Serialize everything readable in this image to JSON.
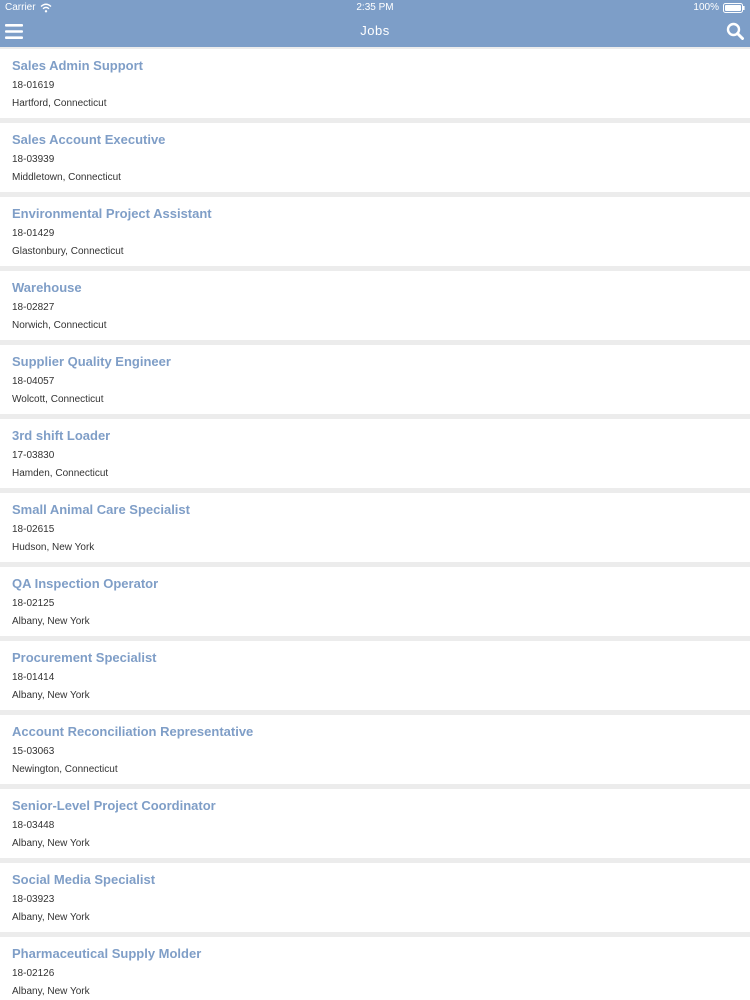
{
  "status_bar": {
    "carrier": "Carrier",
    "time": "2:35 PM",
    "battery": "100%"
  },
  "nav": {
    "title": "Jobs",
    "menu_icon": "hamburger-menu-icon",
    "search_icon": "search-icon"
  },
  "colors": {
    "header": "#7d9ec8",
    "job_title": "#7f9ec7",
    "background": "#ececec"
  },
  "jobs": [
    {
      "title": "Sales Admin Support",
      "code": "18-01619",
      "location": "Hartford, Connecticut"
    },
    {
      "title": "Sales Account Executive",
      "code": "18-03939",
      "location": "Middletown, Connecticut"
    },
    {
      "title": "Environmental Project Assistant",
      "code": "18-01429",
      "location": "Glastonbury, Connecticut"
    },
    {
      "title": "Warehouse",
      "code": "18-02827",
      "location": "Norwich, Connecticut"
    },
    {
      "title": "Supplier Quality Engineer",
      "code": "18-04057",
      "location": "Wolcott, Connecticut"
    },
    {
      "title": "3rd shift Loader",
      "code": "17-03830",
      "location": "Hamden, Connecticut"
    },
    {
      "title": "Small Animal Care Specialist",
      "code": "18-02615",
      "location": "Hudson, New York"
    },
    {
      "title": "QA Inspection Operator",
      "code": "18-02125",
      "location": "Albany, New York"
    },
    {
      "title": "Procurement Specialist",
      "code": "18-01414",
      "location": "Albany, New York"
    },
    {
      "title": "Account Reconciliation Representative",
      "code": "15-03063",
      "location": "Newington, Connecticut"
    },
    {
      "title": "Senior-Level Project Coordinator",
      "code": "18-03448",
      "location": "Albany, New York"
    },
    {
      "title": "Social Media Specialist",
      "code": "18-03923",
      "location": "Albany, New York"
    },
    {
      "title": "Pharmaceutical Supply Molder",
      "code": "18-02126",
      "location": "Albany, New York"
    }
  ]
}
